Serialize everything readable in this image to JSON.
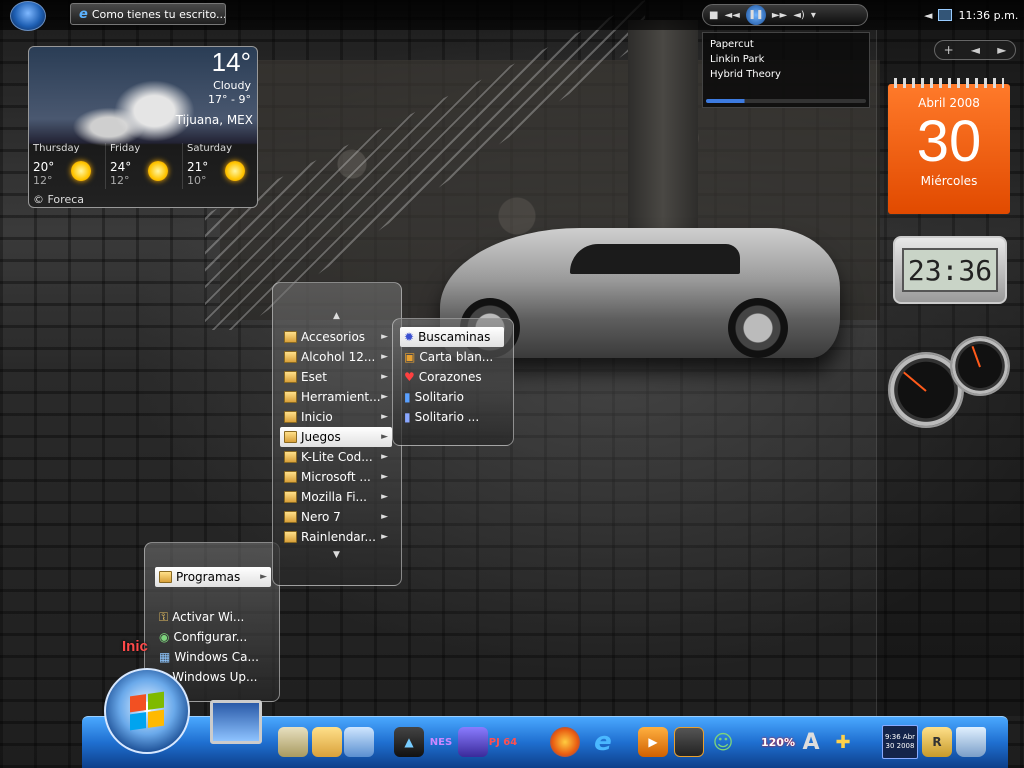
{
  "taskbar": {
    "window_button": "Como tienes tu escrito...",
    "clock": "11:36 p.m."
  },
  "media_player": {
    "track": "Papercut",
    "artist": "Linkin Park",
    "album": "Hybrid Theory",
    "progress": 0.24,
    "controls": [
      "stop",
      "previous",
      "pause",
      "next",
      "volume"
    ]
  },
  "weather": {
    "temperature": "14°",
    "condition": "Cloudy",
    "range": "17° - 9°",
    "city": "Tijuana, MEX",
    "forecast": [
      {
        "day": "Thursday",
        "high": "20°",
        "low": "12°"
      },
      {
        "day": "Friday",
        "high": "24°",
        "low": "12°"
      },
      {
        "day": "Saturday",
        "high": "21°",
        "low": "10°"
      }
    ],
    "credit": "© Foreca"
  },
  "calendar": {
    "month_year": "Abril 2008",
    "day": "30",
    "weekday": "Miércoles"
  },
  "digital_clock": "23:36",
  "sidebar_nav": {
    "add": "+",
    "prev": "◄",
    "next": "►"
  },
  "start_menu": {
    "label": "Inic",
    "programs": "Programas",
    "items": [
      "Activar Wi...",
      "Configurar...",
      "Windows Ca...",
      "Windows Up..."
    ]
  },
  "programs_menu": {
    "items": [
      "Accesorios",
      "Alcohol 12...",
      "Eset",
      "Herramient...",
      "Inicio",
      "Juegos",
      "K-Lite Cod...",
      "Microsoft ...",
      "Mozilla Fi...",
      "Nero 7",
      "Rainlendar..."
    ],
    "selected": "Juegos"
  },
  "games_menu": {
    "items": [
      "Buscaminas",
      "Carta blan...",
      "Corazones",
      "Solitario",
      "Solitario ..."
    ],
    "selected": "Buscaminas"
  },
  "dock": {
    "rainlendar_date": "9:36 Abr 30 2008",
    "badge_120": "120%",
    "rar_letter": "R",
    "nes_label": "NES",
    "pj_label": "PJ 64"
  },
  "colors": {
    "accent_orange": "#e8541a",
    "dock_blue": "#1f6fd0",
    "start_label": "#ff4a4a"
  }
}
